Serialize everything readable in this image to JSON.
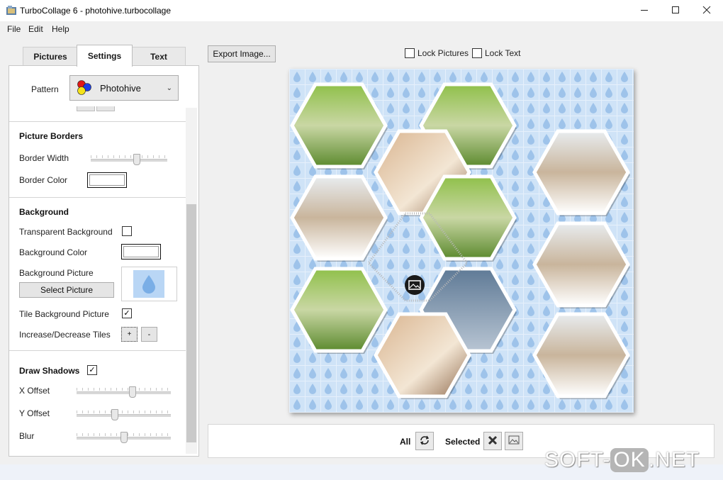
{
  "window": {
    "title": "TurboCollage 6 - photohive.turbocollage"
  },
  "menu": [
    "File",
    "Edit",
    "Help"
  ],
  "tabs": [
    "Pictures",
    "Settings",
    "Text"
  ],
  "settings": {
    "pattern_label": "Pattern",
    "pattern_value": "Photohive",
    "borders": {
      "header": "Picture Borders",
      "width_label": "Border Width",
      "width_level": 0.61,
      "color_label": "Border Color",
      "color": "#ffffff"
    },
    "background": {
      "header": "Background",
      "transparent_label": "Transparent Background",
      "transparent_checked": false,
      "color_label": "Background Color",
      "color": "#ffffff",
      "picture_label": "Background Picture",
      "select_button": "Select Picture",
      "tile_label": "Tile Background Picture",
      "tile_checked": true,
      "tiles_label": "Increase/Decrease Tiles",
      "plus": "+",
      "minus": "-"
    },
    "shadows": {
      "header": "Draw Shadows",
      "checked": true,
      "x_label": "X Offset",
      "x_level": 0.6,
      "y_label": "Y Offset",
      "y_level": 0.4,
      "blur_label": "Blur",
      "blur_level": 0.5
    }
  },
  "toolbar": {
    "export_label": "Export Image...",
    "lock_pictures": "Lock Pictures",
    "lock_text": "Lock Text"
  },
  "bottom": {
    "all_label": "All",
    "selected_label": "Selected"
  },
  "icons": [
    "app-icon",
    "minimize-icon",
    "maximize-icon",
    "close-icon",
    "dropdown-chevron-icon",
    "water-drop-icon",
    "image-placeholder-icon",
    "shuffle-icon",
    "delete-icon",
    "replace-image-icon",
    "checkmark-icon"
  ],
  "colors": {
    "canvas_bg": "#cfe3f7",
    "drop": "#9ec3ea",
    "accent": "#0a64b4"
  },
  "watermark": {
    "part1": "SOFT-",
    "part2": "OK",
    "part3": ".NET"
  }
}
